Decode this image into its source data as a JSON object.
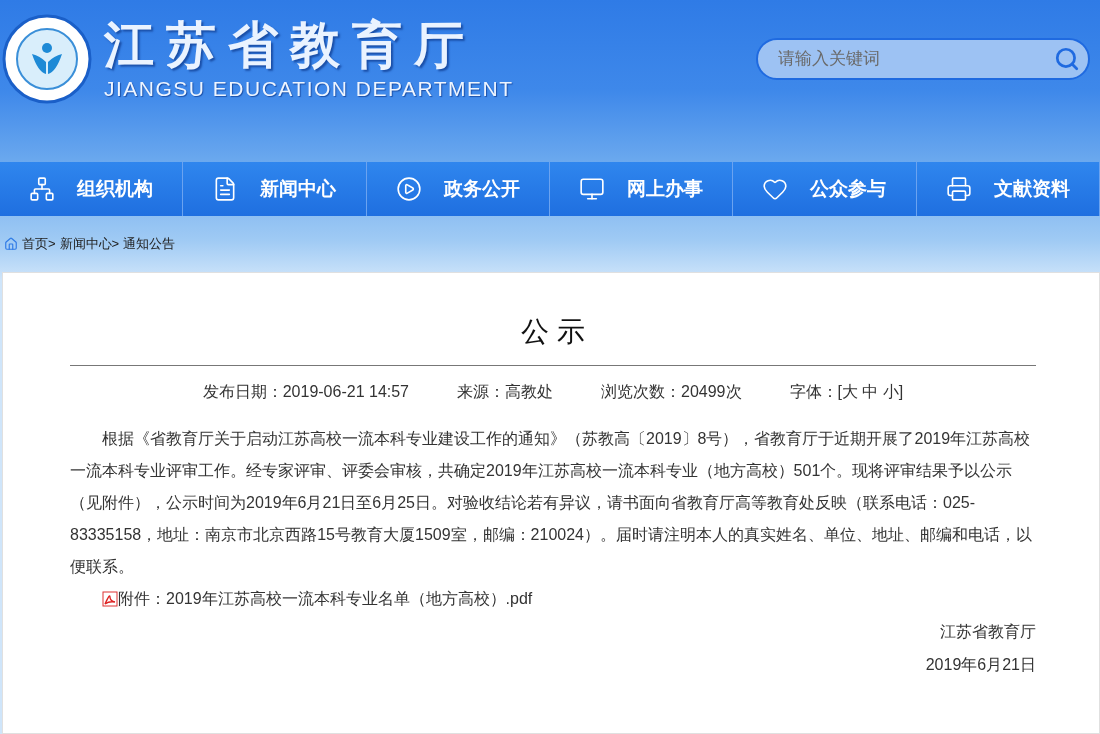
{
  "header": {
    "logo_title": "江苏省教育厅",
    "logo_subtitle": "JIANGSU EDUCATION DEPARTMENT",
    "search": {
      "placeholder": "请输入关键词"
    }
  },
  "nav": [
    {
      "kind": "org",
      "label": "组织机构"
    },
    {
      "kind": "doc",
      "label": "新闻中心"
    },
    {
      "kind": "play",
      "label": "政务公开"
    },
    {
      "kind": "monitor",
      "label": "网上办事"
    },
    {
      "kind": "heart",
      "label": "公众参与"
    },
    {
      "kind": "printer",
      "label": "文献资料"
    }
  ],
  "breadcrumb": [
    "首页>",
    "新闻中心>",
    "通知公告"
  ],
  "article": {
    "title": "公 示",
    "meta": [
      "发布日期：2019-06-21 14:57",
      "来源：高教处",
      "浏览次数：20499次",
      "字体：[大 中 小]"
    ],
    "body": "根据《省教育厅关于启动江苏高校一流本科专业建设工作的通知》（苏教高〔2019〕8号），省教育厅于近期开展了2019年江苏高校一流本科专业评审工作。经专家评审、评委会审核，共确定2019年江苏高校一流本科专业（地方高校）501个。现将评审结果予以公示（见附件），公示时间为2019年6月21日至6月25日。对验收结论若有异议，请书面向省教育厅高等教育处反映（联系电话：025-83335158，地址：南京市北京西路15号教育大厦1509室，邮编：210024）。届时请注明本人的真实姓名、单位、地址、邮编和电话，以便联系。",
    "attachment": "附件：2019年江苏高校一流本科专业名单（地方高校）.pdf",
    "signature": [
      "江苏省教育厅",
      "2019年6月21日"
    ]
  }
}
